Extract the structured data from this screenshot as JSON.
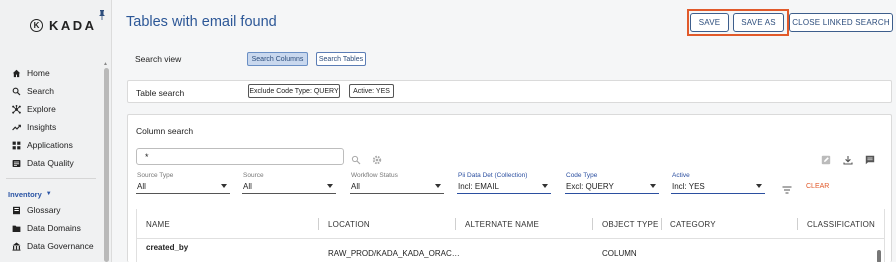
{
  "brand": {
    "logo_mark": "K",
    "name": "KADA"
  },
  "sidebar": {
    "items": [
      {
        "label": "Home",
        "icon": "home-icon"
      },
      {
        "label": "Search",
        "icon": "search-icon"
      },
      {
        "label": "Explore",
        "icon": "explore-icon"
      },
      {
        "label": "Insights",
        "icon": "insights-icon"
      },
      {
        "label": "Applications",
        "icon": "applications-icon"
      },
      {
        "label": "Data Quality",
        "icon": "data-quality-icon"
      }
    ],
    "section_label": "Inventory",
    "inventory_items": [
      {
        "label": "Glossary",
        "icon": "glossary-icon"
      },
      {
        "label": "Data Domains",
        "icon": "data-domains-icon"
      },
      {
        "label": "Data Governance",
        "icon": "data-governance-icon"
      }
    ]
  },
  "header": {
    "title": "Tables with email found",
    "save_label": "SAVE",
    "save_as_label": "SAVE AS",
    "close_label": "CLOSE LINKED SEARCH"
  },
  "search_view": {
    "label": "Search view",
    "options": [
      "Search Columns",
      "Search Tables"
    ],
    "selected": "Search Columns"
  },
  "table_search": {
    "label": "Table search",
    "chips": [
      "Exclude Code Type: QUERY",
      "Active: YES"
    ]
  },
  "column_search": {
    "label": "Column search",
    "query": "*",
    "filters": [
      {
        "label": "Source Type",
        "value": "All"
      },
      {
        "label": "Source",
        "value": "All"
      },
      {
        "label": "Workflow Status",
        "value": "All"
      },
      {
        "label": "Pii Data Det (Collection)",
        "value": "Incl: EMAIL"
      },
      {
        "label": "Code Type",
        "value": "Excl: QUERY"
      },
      {
        "label": "Active",
        "value": "Incl: YES"
      }
    ],
    "clear_label": "CLEAR"
  },
  "results": {
    "columns": [
      "NAME",
      "LOCATION",
      "ALTERNATE NAME",
      "OBJECT TYPE",
      "CATEGORY",
      "CLASSIFICATION"
    ],
    "rows": [
      {
        "name": "created_by",
        "location": "RAW_PROD/KADA_KADA_ORAC…",
        "alternate_name": "",
        "object_type": "COLUMN",
        "category": "",
        "classification": ""
      }
    ]
  },
  "colors": {
    "title": "#2c5797",
    "accent_orange": "#e15a2b",
    "chip_selected": "#c9d8ee",
    "filter_blue": "#2b4fa0"
  }
}
